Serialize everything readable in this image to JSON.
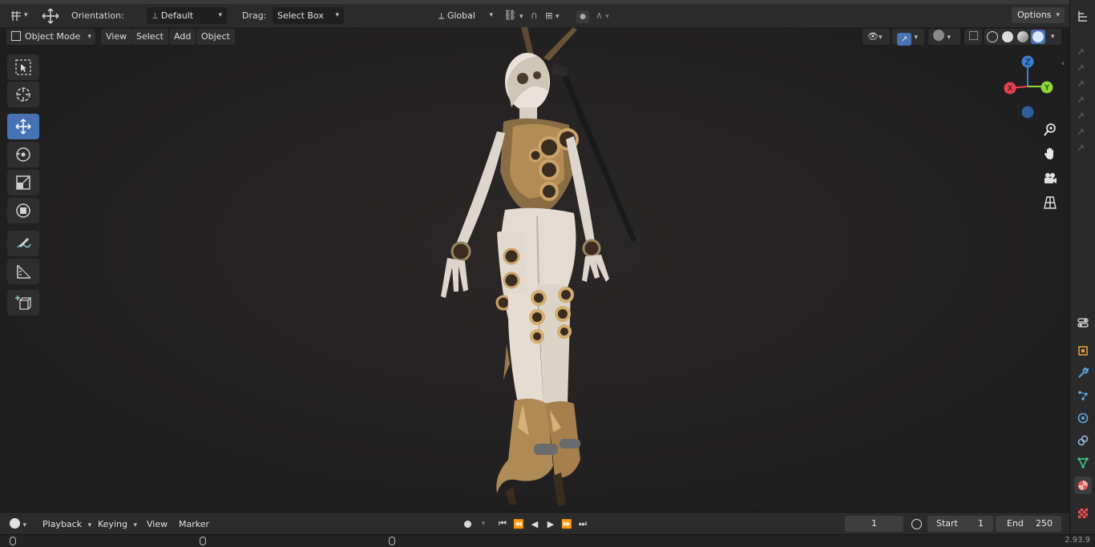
{
  "header": {
    "orientation_label": "Orientation:",
    "orientation_value": "Default",
    "drag_label": "Drag:",
    "drag_value": "Select Box",
    "transform_space": "Global",
    "options_label": "Options"
  },
  "viewport_header": {
    "mode": "Object Mode",
    "menus": [
      "View",
      "Select",
      "Add",
      "Object"
    ]
  },
  "toolbar": {
    "tools": [
      "select-box",
      "cursor",
      "move",
      "rotate",
      "scale",
      "transform",
      "annotate",
      "measure",
      "add-cube"
    ],
    "active_tool": "move"
  },
  "gizmo": {
    "z": "Z",
    "x": "X",
    "y": "Y"
  },
  "timeline": {
    "menus": [
      "Playback",
      "Keying",
      "View",
      "Marker"
    ],
    "current_frame": "1",
    "start_label": "Start",
    "start_value": "1",
    "end_label": "End",
    "end_value": "250"
  },
  "status": {
    "version": "2.93.9"
  },
  "colors": {
    "accent": "#4772b3",
    "axis_x": "#e8414e",
    "axis_y": "#8bd83a",
    "axis_z": "#3d7fd6"
  }
}
